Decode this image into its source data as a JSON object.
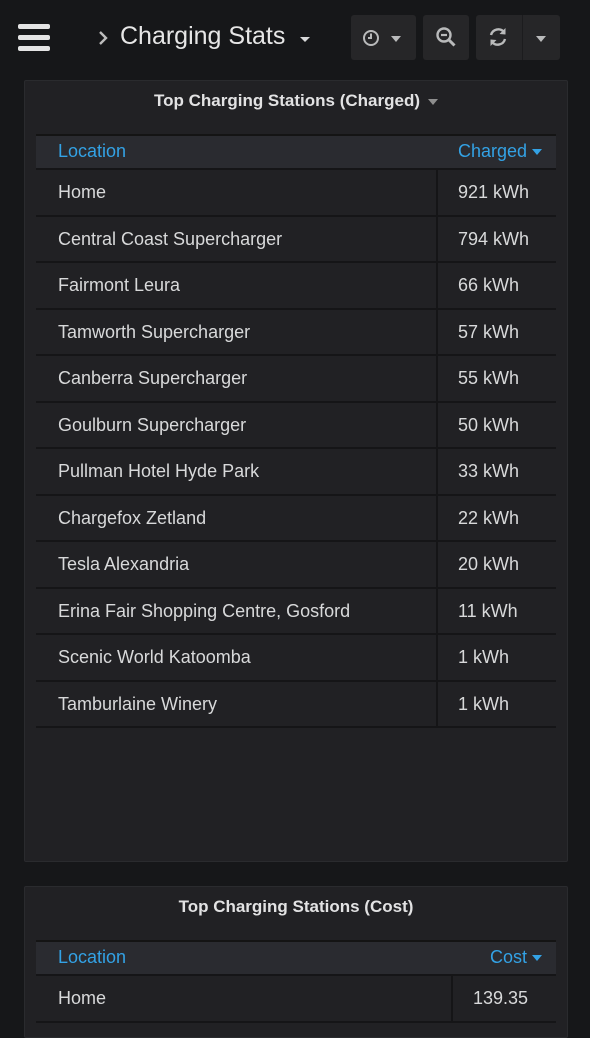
{
  "nav": {
    "title": "Charging Stats",
    "icons": {
      "menu": "hamburger-menu-icon",
      "breadcrumb": "chevron-right-icon",
      "time": "clock-icon",
      "zoom": "zoom-out-icon",
      "refresh": "refresh-icon"
    }
  },
  "panels": [
    {
      "title": "Top Charging Stations (Charged)",
      "columns": {
        "location": "Location",
        "value": "Charged"
      },
      "rows": [
        {
          "location": "Home",
          "value": "921 kWh"
        },
        {
          "location": "Central Coast Supercharger",
          "value": "794 kWh"
        },
        {
          "location": "Fairmont Leura",
          "value": "66 kWh"
        },
        {
          "location": "Tamworth Supercharger",
          "value": "57 kWh"
        },
        {
          "location": "Canberra Supercharger",
          "value": "55 kWh"
        },
        {
          "location": "Goulburn Supercharger",
          "value": "50 kWh"
        },
        {
          "location": "Pullman Hotel Hyde Park",
          "value": "33 kWh"
        },
        {
          "location": "Chargefox Zetland",
          "value": "22 kWh"
        },
        {
          "location": "Tesla Alexandria",
          "value": "20 kWh"
        },
        {
          "location": "Erina Fair Shopping Centre, Gosford",
          "value": "11 kWh"
        },
        {
          "location": "Scenic World Katoomba",
          "value": "1 kWh"
        },
        {
          "location": "Tamburlaine Winery",
          "value": "1 kWh"
        }
      ]
    },
    {
      "title": "Top Charging Stations (Cost)",
      "columns": {
        "location": "Location",
        "value": "Cost"
      },
      "rows": [
        {
          "location": "Home",
          "value": "139.35"
        }
      ]
    }
  ],
  "colors": {
    "background": "#161719",
    "panel": "#212124",
    "header_link": "#33a2e5",
    "text": "#d8d9da"
  }
}
